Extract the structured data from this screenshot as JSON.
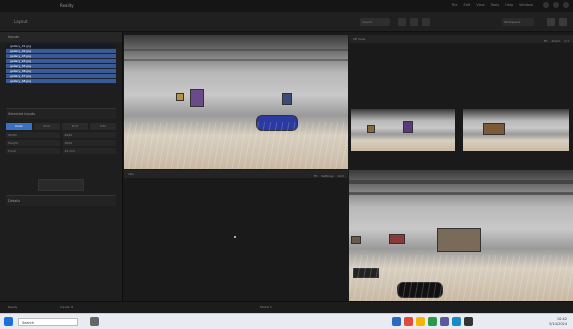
{
  "titlebar": {
    "app_name": "Reality",
    "menus": [
      "File",
      "Edit",
      "View",
      "Tools",
      "Help",
      "Window"
    ]
  },
  "toolbar": {
    "left_label": "Layout",
    "search_placeholder": "Search",
    "dropdown_value": "Workspace"
  },
  "sidebar": {
    "header": "Inputs",
    "files": [
      {
        "name": "gallery_01.jpg",
        "selected": false
      },
      {
        "name": "gallery_02.jpg",
        "selected": true
      },
      {
        "name": "gallery_03.jpg",
        "selected": true
      },
      {
        "name": "gallery_04.jpg",
        "selected": true
      },
      {
        "name": "gallery_05.jpg",
        "selected": true
      },
      {
        "name": "gallery_06.jpg",
        "selected": true
      },
      {
        "name": "gallery_07.jpg",
        "selected": true
      },
      {
        "name": "gallery_08.jpg",
        "selected": true
      }
    ],
    "section_title": "Selected inputs",
    "tabs": [
      {
        "label": "Color",
        "active": true
      },
      {
        "label": "Prior",
        "active": false
      },
      {
        "label": "Exif",
        "active": false
      },
      {
        "label": "Info",
        "active": false
      }
    ],
    "rows": [
      {
        "label": "Width",
        "value": "4000"
      },
      {
        "label": "Height",
        "value": "3000"
      },
      {
        "label": "Focal",
        "value": "24 mm"
      }
    ],
    "footer_label": "Details"
  },
  "viewports": {
    "top_left": {
      "title": "3D View"
    },
    "top_right": {
      "title": "2D View",
      "tools": [
        "Fit",
        "Zoom",
        "1:1"
      ]
    },
    "bottom_left": {
      "title": "1Ds",
      "tools": [
        "Fit",
        "Settings",
        "Grid"
      ]
    },
    "bottom_right": {
      "title": "Image"
    }
  },
  "status": {
    "left": "Ready",
    "mid": "Inputs: 8",
    "right": "Model 1"
  },
  "taskbar": {
    "search_text": "Search",
    "time": "10:42",
    "date": "3/14/2024"
  }
}
